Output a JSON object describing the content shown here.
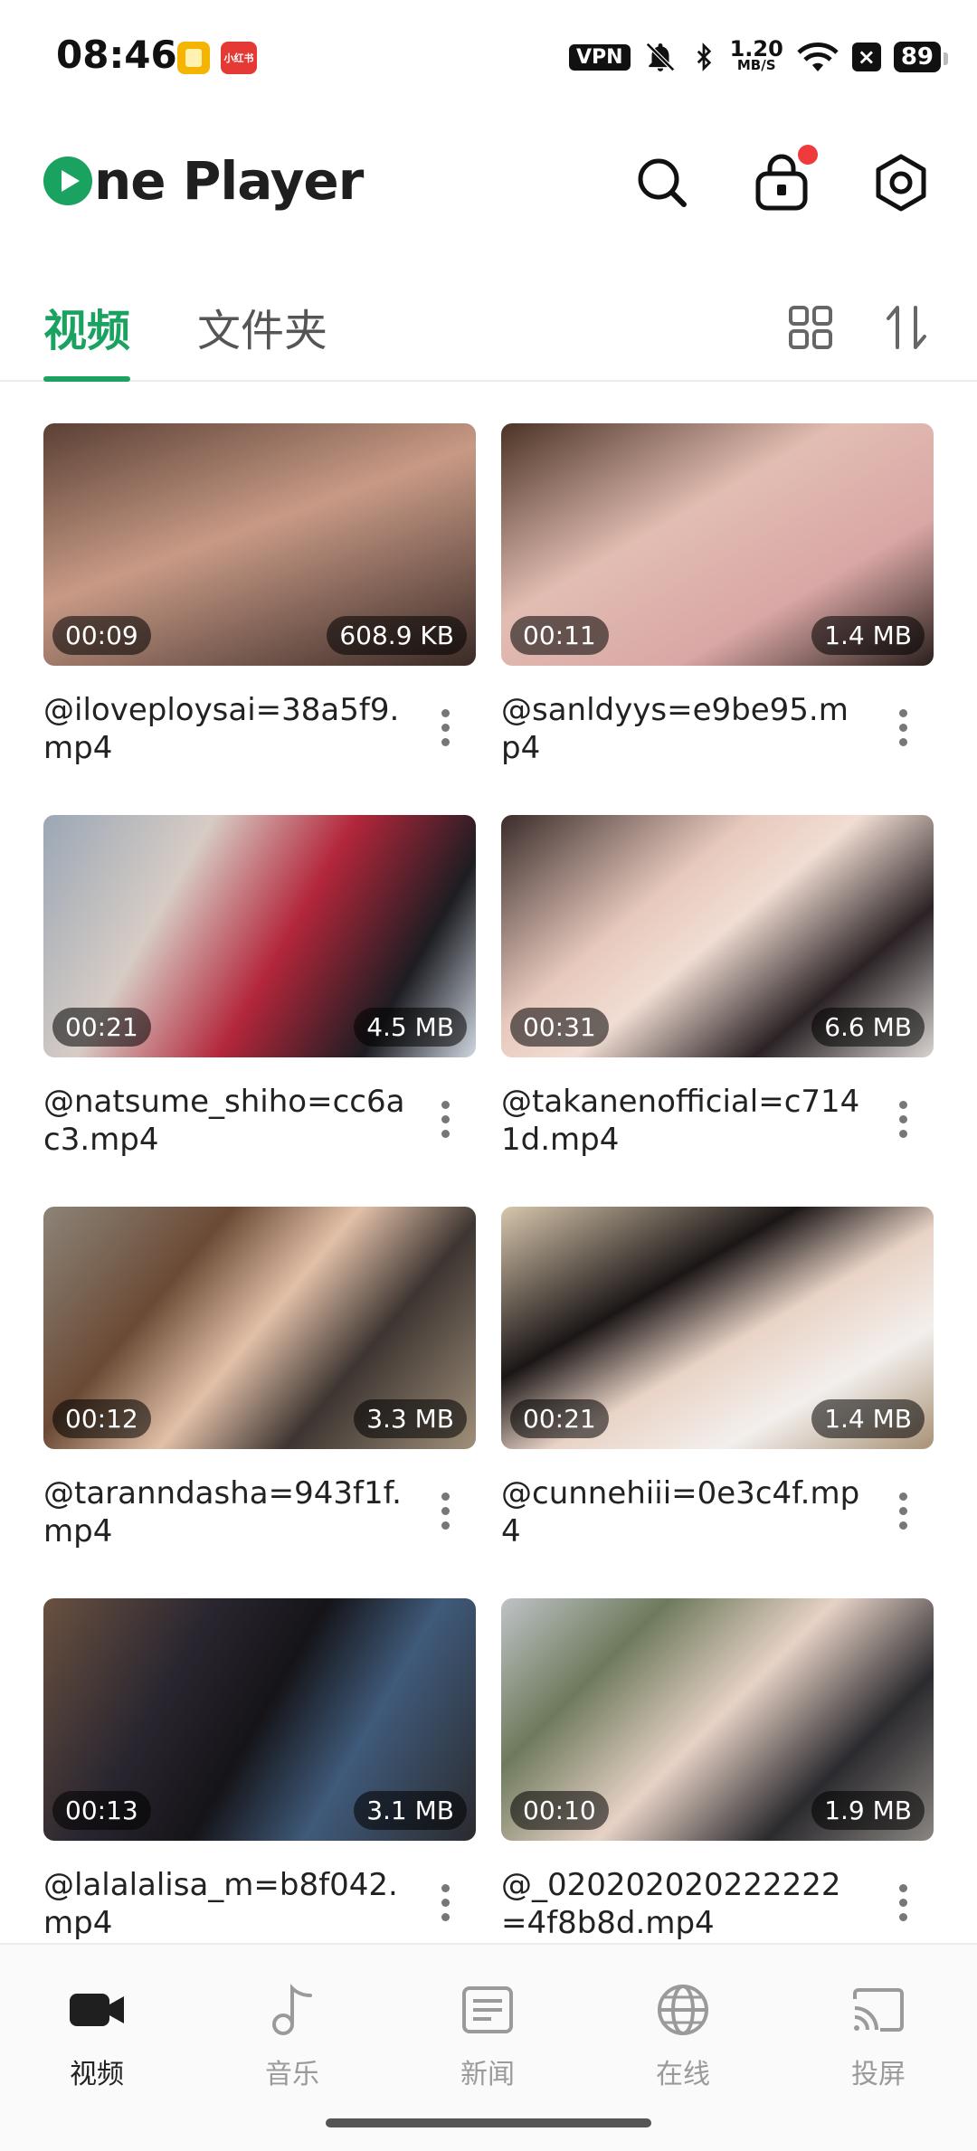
{
  "status_bar": {
    "time": "08:46",
    "app2_label": "小红书",
    "vpn": "VPN",
    "speed_value": "1.20",
    "speed_unit": "MB/S",
    "battery": "89"
  },
  "header": {
    "logo_text": "ne Player",
    "icons": [
      "search-icon",
      "lock-icon",
      "settings-icon"
    ],
    "lock_has_notification": true
  },
  "tabs": {
    "items": [
      "视频",
      "文件夹"
    ],
    "active_index": 0
  },
  "videos": [
    {
      "duration": "00:09",
      "size": "608.9 KB",
      "name": "@iloveploysai=38a5f9.mp4",
      "thumb_color": "#8b6a5a"
    },
    {
      "duration": "00:11",
      "size": "1.4 MB",
      "name": "@sanldyys=e9be95.mp4",
      "thumb_color": "#c7a39a"
    },
    {
      "duration": "00:21",
      "size": "4.5 MB",
      "name": "@natsume_shiho=cc6ac3.mp4",
      "thumb_color": "#b3263a"
    },
    {
      "duration": "00:31",
      "size": "6.6 MB",
      "name": "@takanenofficial=c7141d.mp4",
      "thumb_color": "#5a4540"
    },
    {
      "duration": "00:12",
      "size": "3.3 MB",
      "name": "@taranndasha=943f1f.mp4",
      "thumb_color": "#7a6550"
    },
    {
      "duration": "00:21",
      "size": "1.4 MB",
      "name": "@cunnehiii=0e3c4f.mp4",
      "thumb_color": "#b8a088"
    },
    {
      "duration": "00:13",
      "size": "3.1 MB",
      "name": "@lalalalisa_m=b8f042.mp4",
      "thumb_color": "#2f2a30"
    },
    {
      "duration": "00:10",
      "size": "1.9 MB",
      "name": "@_020202020222222=4f8b8d.mp4",
      "thumb_color": "#6c6660"
    }
  ],
  "bottom_nav": {
    "items": [
      {
        "label": "视频",
        "icon": "video-camera-icon"
      },
      {
        "label": "音乐",
        "icon": "music-note-icon"
      },
      {
        "label": "新闻",
        "icon": "news-icon"
      },
      {
        "label": "在线",
        "icon": "globe-icon"
      },
      {
        "label": "投屏",
        "icon": "cast-icon"
      }
    ],
    "active_index": 0
  },
  "colors": {
    "accent": "#1aa260",
    "notification": "#ef3b3b"
  }
}
